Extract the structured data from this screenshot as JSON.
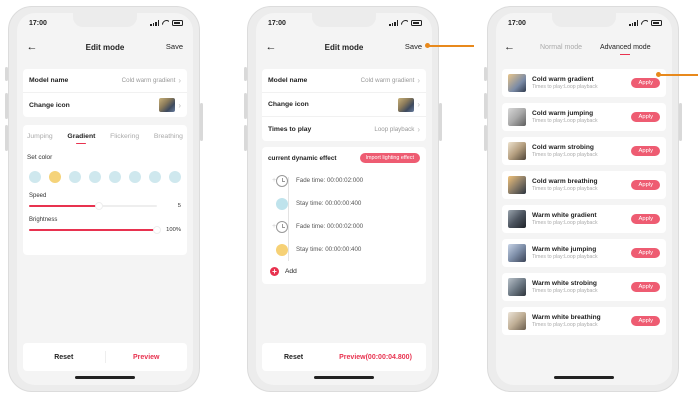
{
  "status": {
    "time": "17:00"
  },
  "colors": {
    "accent": "#e8324f",
    "apply_pill": "#ee5c72",
    "callout": "#e8891c",
    "dot_blue": "#cfe8ee",
    "dot_yellow": "#f5d37a"
  },
  "screen1": {
    "title": "Edit mode",
    "save_label": "Save",
    "rows": [
      {
        "label": "Model name",
        "value": "Cold warm gradient"
      },
      {
        "label": "Change icon"
      }
    ],
    "modes": [
      "Jumping",
      "Gradient",
      "Flickering",
      "Breathing"
    ],
    "active_mode": "Gradient",
    "set_color_label": "Set color",
    "color_swatches": 8,
    "selected_swatch": 2,
    "speed": {
      "label": "Speed",
      "value": "5",
      "fill_percent": 55
    },
    "brightness": {
      "label": "Brightness",
      "value": "100%",
      "fill_percent": 100
    },
    "reset_label": "Reset",
    "preview_label": "Preview"
  },
  "screen2": {
    "title": "Edit mode",
    "save_label": "Save",
    "rows": [
      {
        "label": "Model name",
        "value": "Cold warm gradient"
      },
      {
        "label": "Change icon"
      },
      {
        "label": "Times to play",
        "value": "Loop playback"
      }
    ],
    "effect_label": "current dynamic effect",
    "import_label": "Import lighting effect",
    "timeline": [
      {
        "kind": "fade",
        "text": "Fade time: 00:00:02:000"
      },
      {
        "kind": "stay",
        "color": "blue",
        "text": "Stay time: 00:00:00:400"
      },
      {
        "kind": "fade",
        "text": "Fade time: 00:00:02:000"
      },
      {
        "kind": "stay",
        "color": "yellow",
        "text": "Stay time: 00:00:00:400"
      }
    ],
    "add_label": "Add",
    "reset_label": "Reset",
    "preview_label": "Preview(00:00:04.800)"
  },
  "screen3": {
    "tab_normal": "Normal mode",
    "tab_advanced": "Advanced mode",
    "apply_label": "Apply",
    "sub_label": "Times to play:Loop playback",
    "presets": [
      {
        "name": "Cold warm gradient"
      },
      {
        "name": "Cold warm jumping"
      },
      {
        "name": "Cold warm strobing"
      },
      {
        "name": "Cold warm breathing"
      },
      {
        "name": "Warm white gradient"
      },
      {
        "name": "Warm white jumping"
      },
      {
        "name": "Warm white strobing"
      },
      {
        "name": "Warm white breathing"
      }
    ]
  }
}
